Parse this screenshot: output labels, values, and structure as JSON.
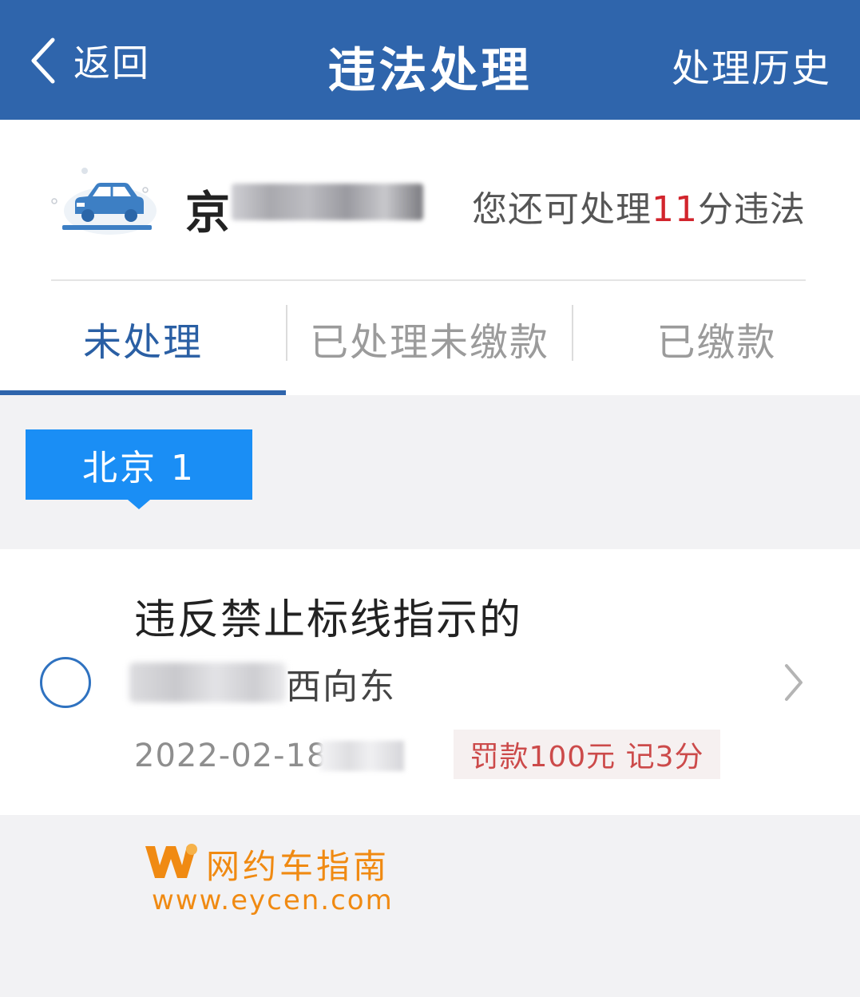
{
  "header": {
    "back_label": "返回",
    "title": "违法处理",
    "history_label": "处理历史"
  },
  "vehicle": {
    "plate_prefix": "京",
    "points_prefix": "您还可处理",
    "points_value": "11",
    "points_suffix": "分违法"
  },
  "tabs": [
    {
      "label": "未处理",
      "active": true
    },
    {
      "label": "已处理未缴款",
      "active": false
    },
    {
      "label": "已缴款",
      "active": false
    }
  ],
  "region": {
    "label": "北京 1"
  },
  "violations": [
    {
      "title": "违反禁止标线指示的",
      "location_suffix": "西向东",
      "date": "2022-02-18",
      "penalty": "罚款100元 记3分"
    }
  ],
  "watermark": {
    "name": "网约车指南",
    "url": "www.eycen.com"
  },
  "colors": {
    "header_bg": "#2f65ac",
    "accent_blue": "#1a8ef5",
    "points_red": "#d2252d",
    "penalty_red": "#cc4a4a",
    "watermark_orange": "#f08a12"
  }
}
